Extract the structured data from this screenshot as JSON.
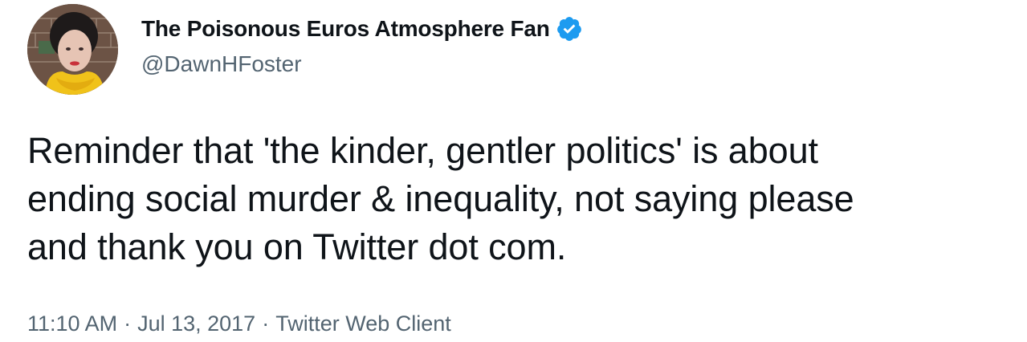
{
  "author": {
    "display_name": "The Poisonous Euros Atmosphere Fan",
    "handle": "@DawnHFoster",
    "verified": true,
    "avatar_icon": "profile-photo-icon"
  },
  "tweet": {
    "text": "Reminder that 'the kinder, gentler politics' is about\nending social murder & inequality, not saying please\nand thank you on Twitter dot com."
  },
  "meta": {
    "time": "11:10 AM",
    "separator": "·",
    "date": "Jul 13, 2017",
    "source": "Twitter Web Client"
  },
  "colors": {
    "text_primary": "#0f1419",
    "text_secondary": "#536471",
    "verified_badge": "#1d9bf0"
  }
}
